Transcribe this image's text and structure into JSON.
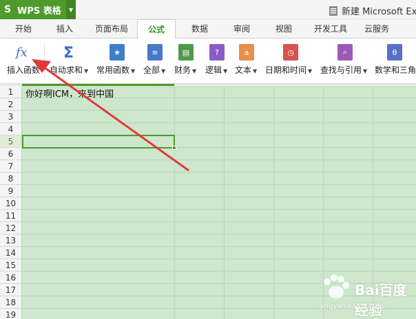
{
  "app": {
    "name": "WPS 表格",
    "document_title": "新建 Microsoft Exc"
  },
  "tabs": [
    {
      "label": "开始",
      "active": false
    },
    {
      "label": "插入",
      "active": false
    },
    {
      "label": "页面布局",
      "active": false
    },
    {
      "label": "公式",
      "active": true
    },
    {
      "label": "数据",
      "active": false
    },
    {
      "label": "审阅",
      "active": false
    },
    {
      "label": "视图",
      "active": false
    },
    {
      "label": "开发工具",
      "active": false
    },
    {
      "label": "云服务",
      "active": false
    }
  ],
  "ribbon": {
    "insert_function": {
      "label": "插入函数",
      "icon": "fx-icon"
    },
    "buttons": [
      {
        "label": "自动求和",
        "icon": "sigma-icon",
        "color": "#3b6fd1"
      },
      {
        "label": "常用函数",
        "icon": "star-icon",
        "color": "#3f7ecb"
      },
      {
        "label": "全部",
        "icon": "list-icon",
        "color": "#4a79c8"
      },
      {
        "label": "财务",
        "icon": "finance-icon",
        "color": "#4e9a48"
      },
      {
        "label": "逻辑",
        "icon": "question-icon",
        "color": "#8b5cc7"
      },
      {
        "label": "文本",
        "icon": "text-a-icon",
        "color": "#e6904a"
      },
      {
        "label": "日期和时间",
        "icon": "clock-icon",
        "color": "#d9534f"
      },
      {
        "label": "查找与引用",
        "icon": "search-icon",
        "color": "#9b59b6"
      },
      {
        "label": "数学和三角",
        "icon": "theta-icon",
        "color": "#5b6fc7"
      }
    ]
  },
  "sheet": {
    "rows": [
      "1",
      "2",
      "3",
      "4",
      "5",
      "6",
      "7",
      "8",
      "9",
      "10",
      "11",
      "12",
      "13",
      "14",
      "15",
      "16",
      "17",
      "18",
      "19"
    ],
    "active_row": "5",
    "cell_a1": "你好啊ICM，来到中国"
  },
  "watermark": {
    "text": "Bai百度 经验",
    "sub": "jingyan.baidu.com"
  },
  "colors": {
    "brand_green": "#4f9a2b",
    "sheet_bg": "#cde6cc",
    "annotation_red": "#e03a3a"
  }
}
